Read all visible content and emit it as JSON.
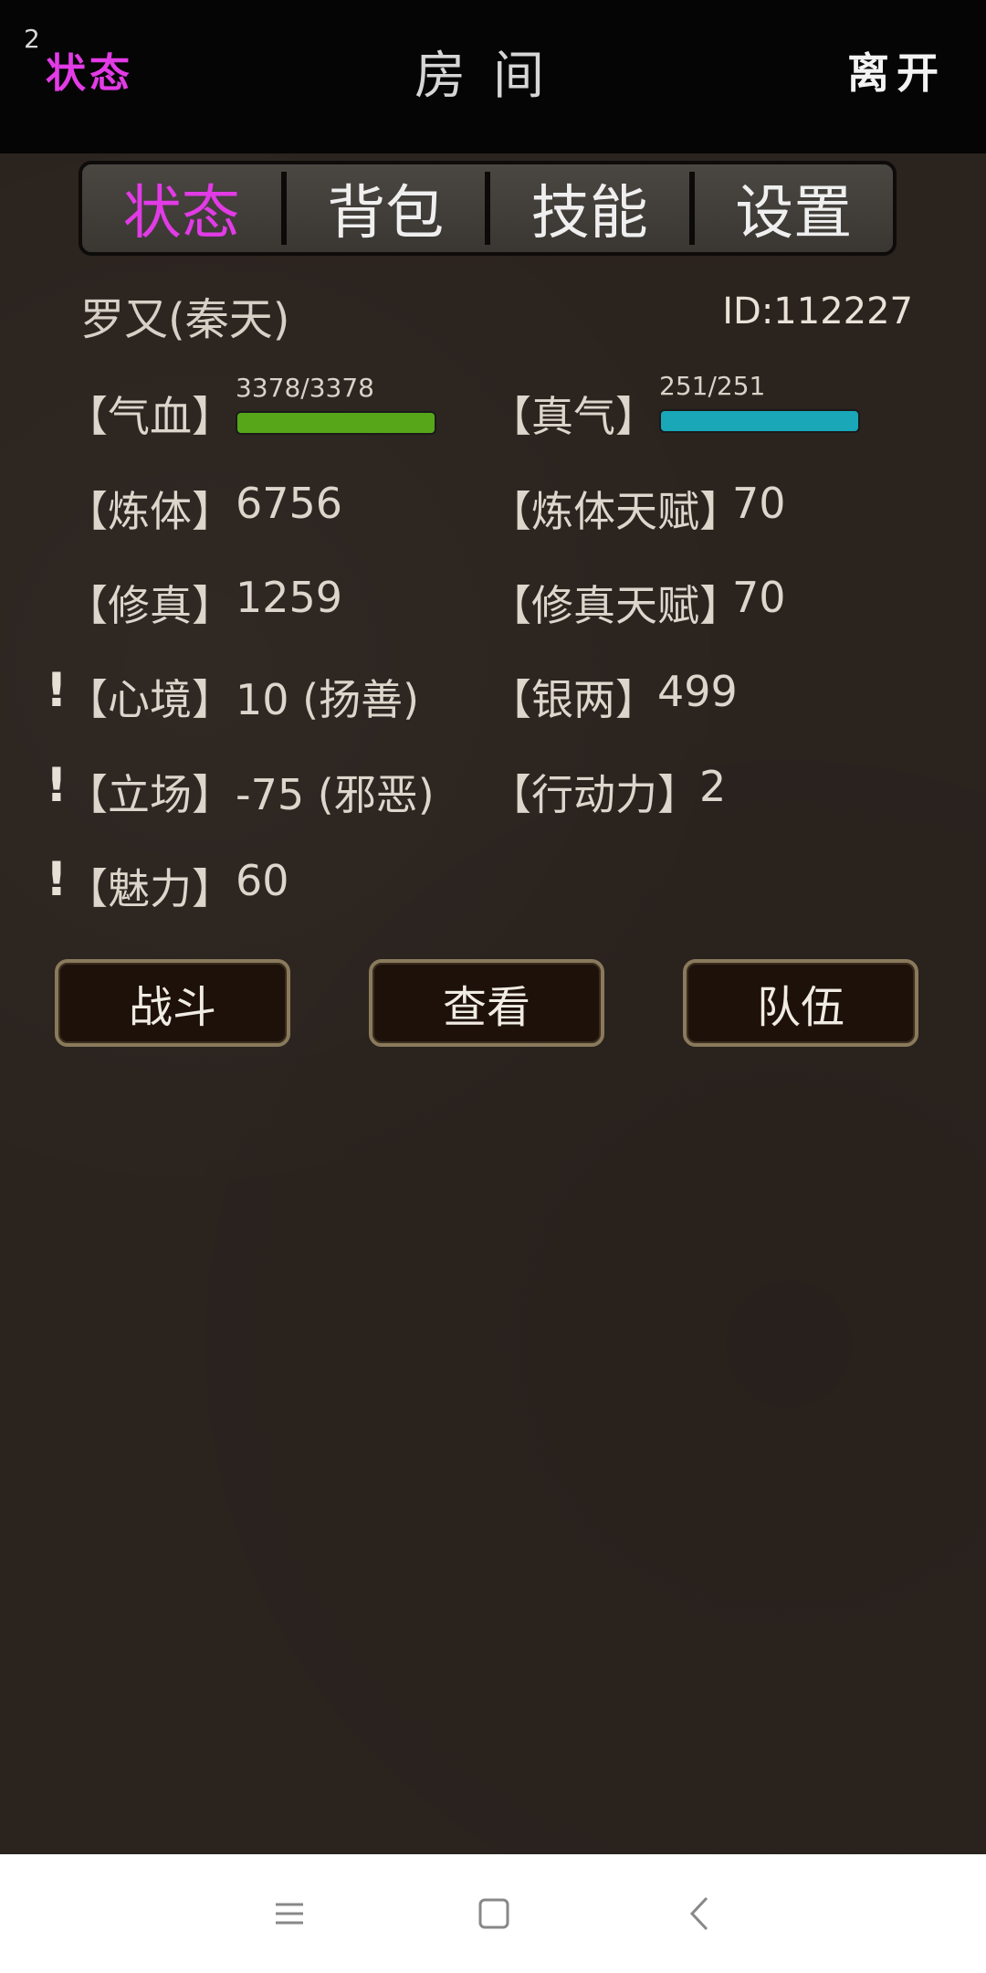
{
  "header": {
    "badge": "2",
    "left": "状态",
    "title": "房间",
    "right": "离开"
  },
  "tabs": [
    {
      "label": "状态",
      "active": true
    },
    {
      "label": "背包",
      "active": false
    },
    {
      "label": "技能",
      "active": false
    },
    {
      "label": "设置",
      "active": false
    }
  ],
  "player": {
    "name": "罗又(秦天)",
    "id": "ID:112227"
  },
  "stats": {
    "hp": {
      "label": "【气血】",
      "value": "3378/3378",
      "fraction": 1.0,
      "color": "#57a61a"
    },
    "qi": {
      "label": "【真气】",
      "value": "251/251",
      "fraction": 1.0,
      "color": "#1aa7b8"
    },
    "body": {
      "label": "【炼体】",
      "value": "6756"
    },
    "body_talent": {
      "label": "【炼体天赋】",
      "value": "70"
    },
    "cultivation": {
      "label": "【修真】",
      "value": "1259"
    },
    "cultivation_talent": {
      "label": "【修真天赋】",
      "value": "70"
    },
    "mood": {
      "label": "【心境】",
      "value": "10 (扬善)",
      "warn": "!"
    },
    "silver": {
      "label": "【银两】",
      "value": "499"
    },
    "stance": {
      "label": "【立场】",
      "value": "-75 (邪恶)",
      "warn": "!"
    },
    "action": {
      "label": "【行动力】",
      "value": "2"
    },
    "charm": {
      "label": "【魅力】",
      "value": "60",
      "warn": "!"
    }
  },
  "buttons": {
    "fight": "战斗",
    "view": "查看",
    "team": "队伍"
  },
  "nav": {
    "menu_icon": "menu-icon",
    "home_icon": "home-icon",
    "back_icon": "back-icon"
  },
  "colors": {
    "accent": "#e23be6",
    "background": "#2b231e"
  }
}
